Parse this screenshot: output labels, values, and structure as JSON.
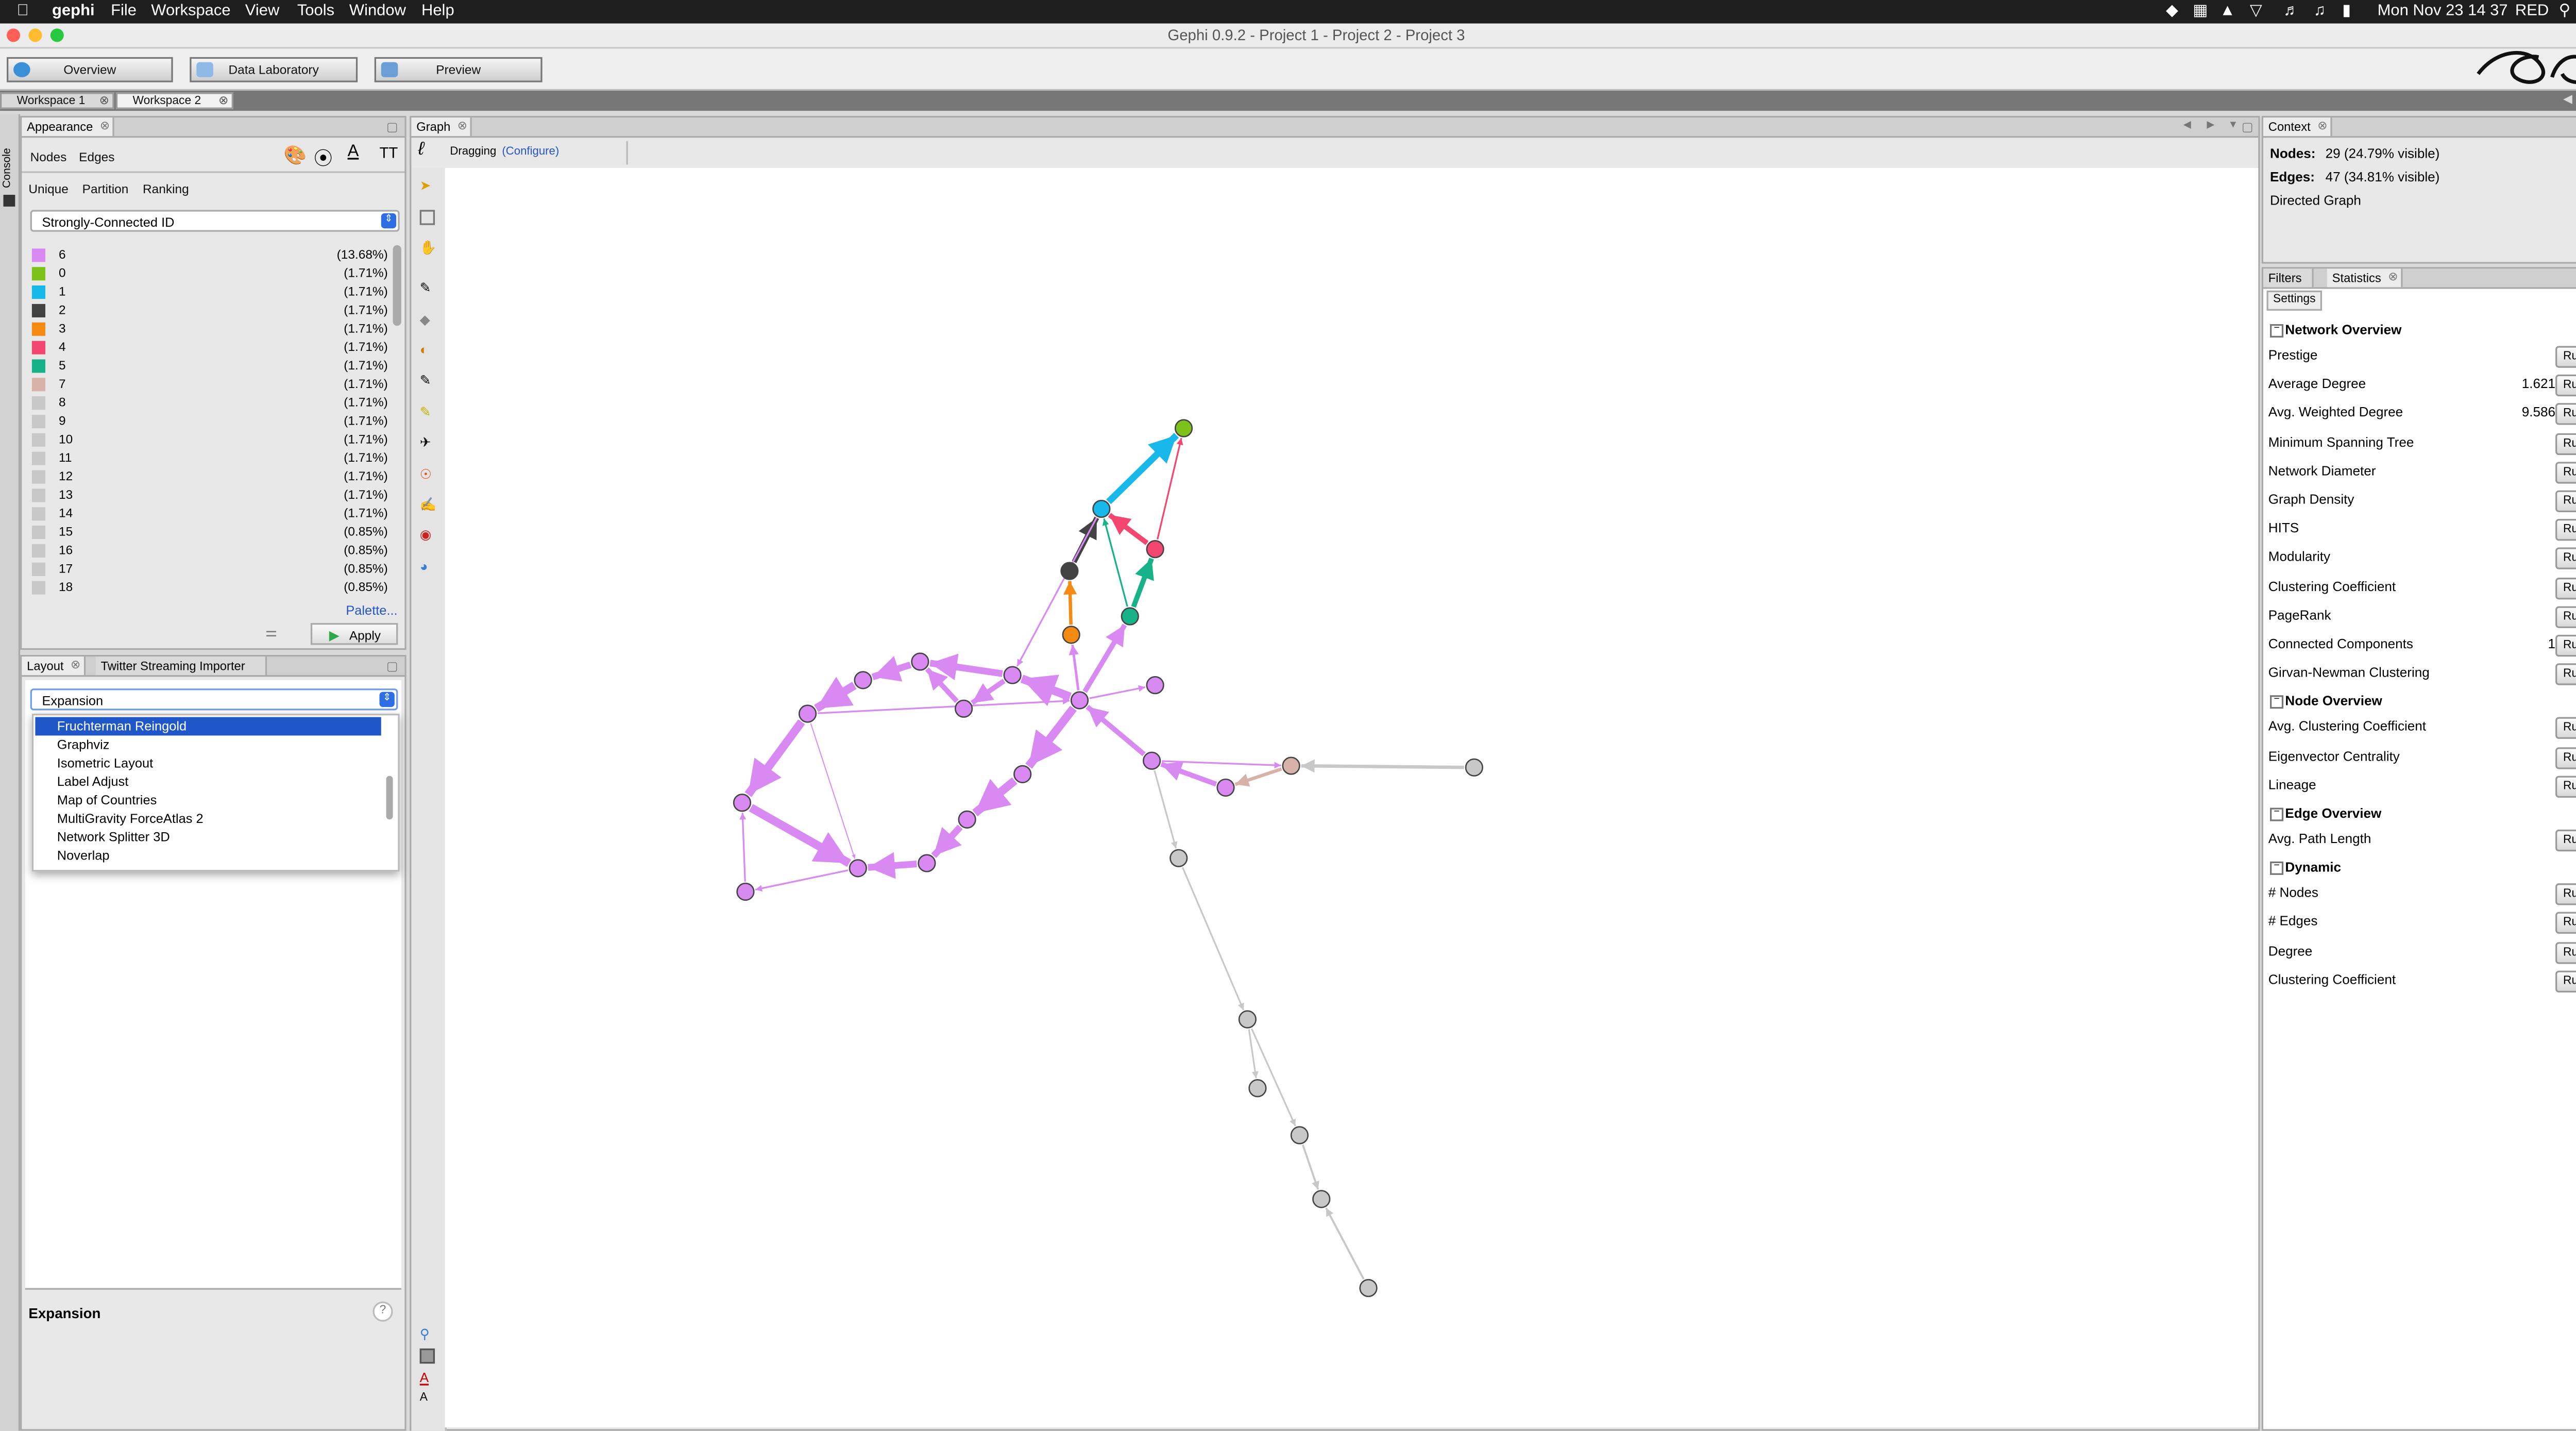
{
  "menubar": {
    "app": "gephi",
    "items": [
      "File",
      "Workspace",
      "View",
      "Tools",
      "Window",
      "Help"
    ],
    "clock": "Mon Nov 23  14 37",
    "user": "RED"
  },
  "window": {
    "title": "Gephi 0.9.2 - Project 1 - Project 2 - Project 3"
  },
  "modes": {
    "overview": "Overview",
    "data_laboratory": "Data Laboratory",
    "preview": "Preview"
  },
  "workspaces": [
    "Workspace 1",
    "Workspace 2"
  ],
  "console_tab": "Console",
  "appearance": {
    "title": "Appearance",
    "subtabs": [
      "Nodes",
      "Edges"
    ],
    "modes": [
      "Unique",
      "Partition",
      "Ranking"
    ],
    "attribute": "Strongly-Connected ID",
    "palette_link": "Palette...",
    "apply": "Apply",
    "partitions": [
      {
        "label": "6",
        "pct": "(13.68%)",
        "color": "#d98af2"
      },
      {
        "label": "0",
        "pct": "(1.71%)",
        "color": "#7cc21b"
      },
      {
        "label": "1",
        "pct": "(1.71%)",
        "color": "#18b8ea"
      },
      {
        "label": "2",
        "pct": "(1.71%)",
        "color": "#424242"
      },
      {
        "label": "3",
        "pct": "(1.71%)",
        "color": "#f48a12"
      },
      {
        "label": "4",
        "pct": "(1.71%)",
        "color": "#f4476f"
      },
      {
        "label": "5",
        "pct": "(1.71%)",
        "color": "#17b288"
      },
      {
        "label": "7",
        "pct": "(1.71%)",
        "color": "#d8b2a8"
      },
      {
        "label": "8",
        "pct": "(1.71%)",
        "color": "#c8c8c8"
      },
      {
        "label": "9",
        "pct": "(1.71%)",
        "color": "#c8c8c8"
      },
      {
        "label": "10",
        "pct": "(1.71%)",
        "color": "#c8c8c8"
      },
      {
        "label": "11",
        "pct": "(1.71%)",
        "color": "#c8c8c8"
      },
      {
        "label": "12",
        "pct": "(1.71%)",
        "color": "#c8c8c8"
      },
      {
        "label": "13",
        "pct": "(1.71%)",
        "color": "#c8c8c8"
      },
      {
        "label": "14",
        "pct": "(1.71%)",
        "color": "#c8c8c8"
      },
      {
        "label": "15",
        "pct": "(0.85%)",
        "color": "#c8c8c8"
      },
      {
        "label": "16",
        "pct": "(0.85%)",
        "color": "#c8c8c8"
      },
      {
        "label": "17",
        "pct": "(0.85%)",
        "color": "#c8c8c8"
      },
      {
        "label": "18",
        "pct": "(0.85%)",
        "color": "#c8c8c8"
      }
    ]
  },
  "layout": {
    "tabs": [
      "Layout",
      "Twitter Streaming Importer"
    ],
    "selected": "Expansion",
    "options": [
      "Fruchterman Reingold",
      "Graphviz",
      "Isometric Layout",
      "Label Adjust",
      "Map of Countries",
      "MultiGravity ForceAtlas 2",
      "Network Splitter 3D",
      "Noverlap"
    ],
    "highlighted_option": "Fruchterman Reingold",
    "description_title": "Expansion",
    "help": "?"
  },
  "graph": {
    "tab": "Graph",
    "mode": "Dragging",
    "configure": "(Configure)"
  },
  "context": {
    "tab": "Context",
    "nodes_label": "Nodes:",
    "nodes_value": "29 (24.79% visible)",
    "edges_label": "Edges:",
    "edges_value": "47 (34.81% visible)",
    "graph_type": "Directed Graph"
  },
  "statistics": {
    "tabs": [
      "Filters",
      "Statistics"
    ],
    "settings": "Settings",
    "run_label": "Run",
    "sections": [
      {
        "title": "Network Overview",
        "items": [
          {
            "name": "Prestige",
            "value": "",
            "info": "grey"
          },
          {
            "name": "Average Degree",
            "value": "1.621",
            "info": "blue"
          },
          {
            "name": "Avg. Weighted Degree",
            "value": "9.586",
            "info": "blue"
          },
          {
            "name": "Minimum Spanning Tree",
            "value": "",
            "info": "grey"
          },
          {
            "name": "Network Diameter",
            "value": "",
            "info": "grey"
          },
          {
            "name": "Graph Density",
            "value": "",
            "info": "grey"
          },
          {
            "name": "HITS",
            "value": "",
            "info": "grey"
          },
          {
            "name": "Modularity",
            "value": "",
            "info": "grey"
          },
          {
            "name": "Clustering Coefficient",
            "value": "",
            "info": "grey"
          },
          {
            "name": "PageRank",
            "value": "",
            "info": "grey"
          },
          {
            "name": "Connected Components",
            "value": "1",
            "info": "blue"
          },
          {
            "name": "Girvan-Newman Clustering",
            "value": "",
            "info": "blue"
          }
        ]
      },
      {
        "title": "Node Overview",
        "items": [
          {
            "name": "Avg. Clustering Coefficient",
            "value": "",
            "info": "grey"
          },
          {
            "name": "Eigenvector Centrality",
            "value": "",
            "info": "grey"
          },
          {
            "name": "Lineage",
            "value": "",
            "info": "grey"
          }
        ]
      },
      {
        "title": "Edge Overview",
        "items": [
          {
            "name": "Avg. Path Length",
            "value": "",
            "info": "grey"
          }
        ]
      },
      {
        "title": "Dynamic",
        "items": [
          {
            "name": "# Nodes",
            "value": "",
            "info": "grey"
          },
          {
            "name": "# Edges",
            "value": "",
            "info": "grey"
          },
          {
            "name": "Degree",
            "value": "",
            "info": "grey"
          },
          {
            "name": "Clustering Coefficient",
            "value": "",
            "info": "grey"
          }
        ]
      }
    ]
  }
}
